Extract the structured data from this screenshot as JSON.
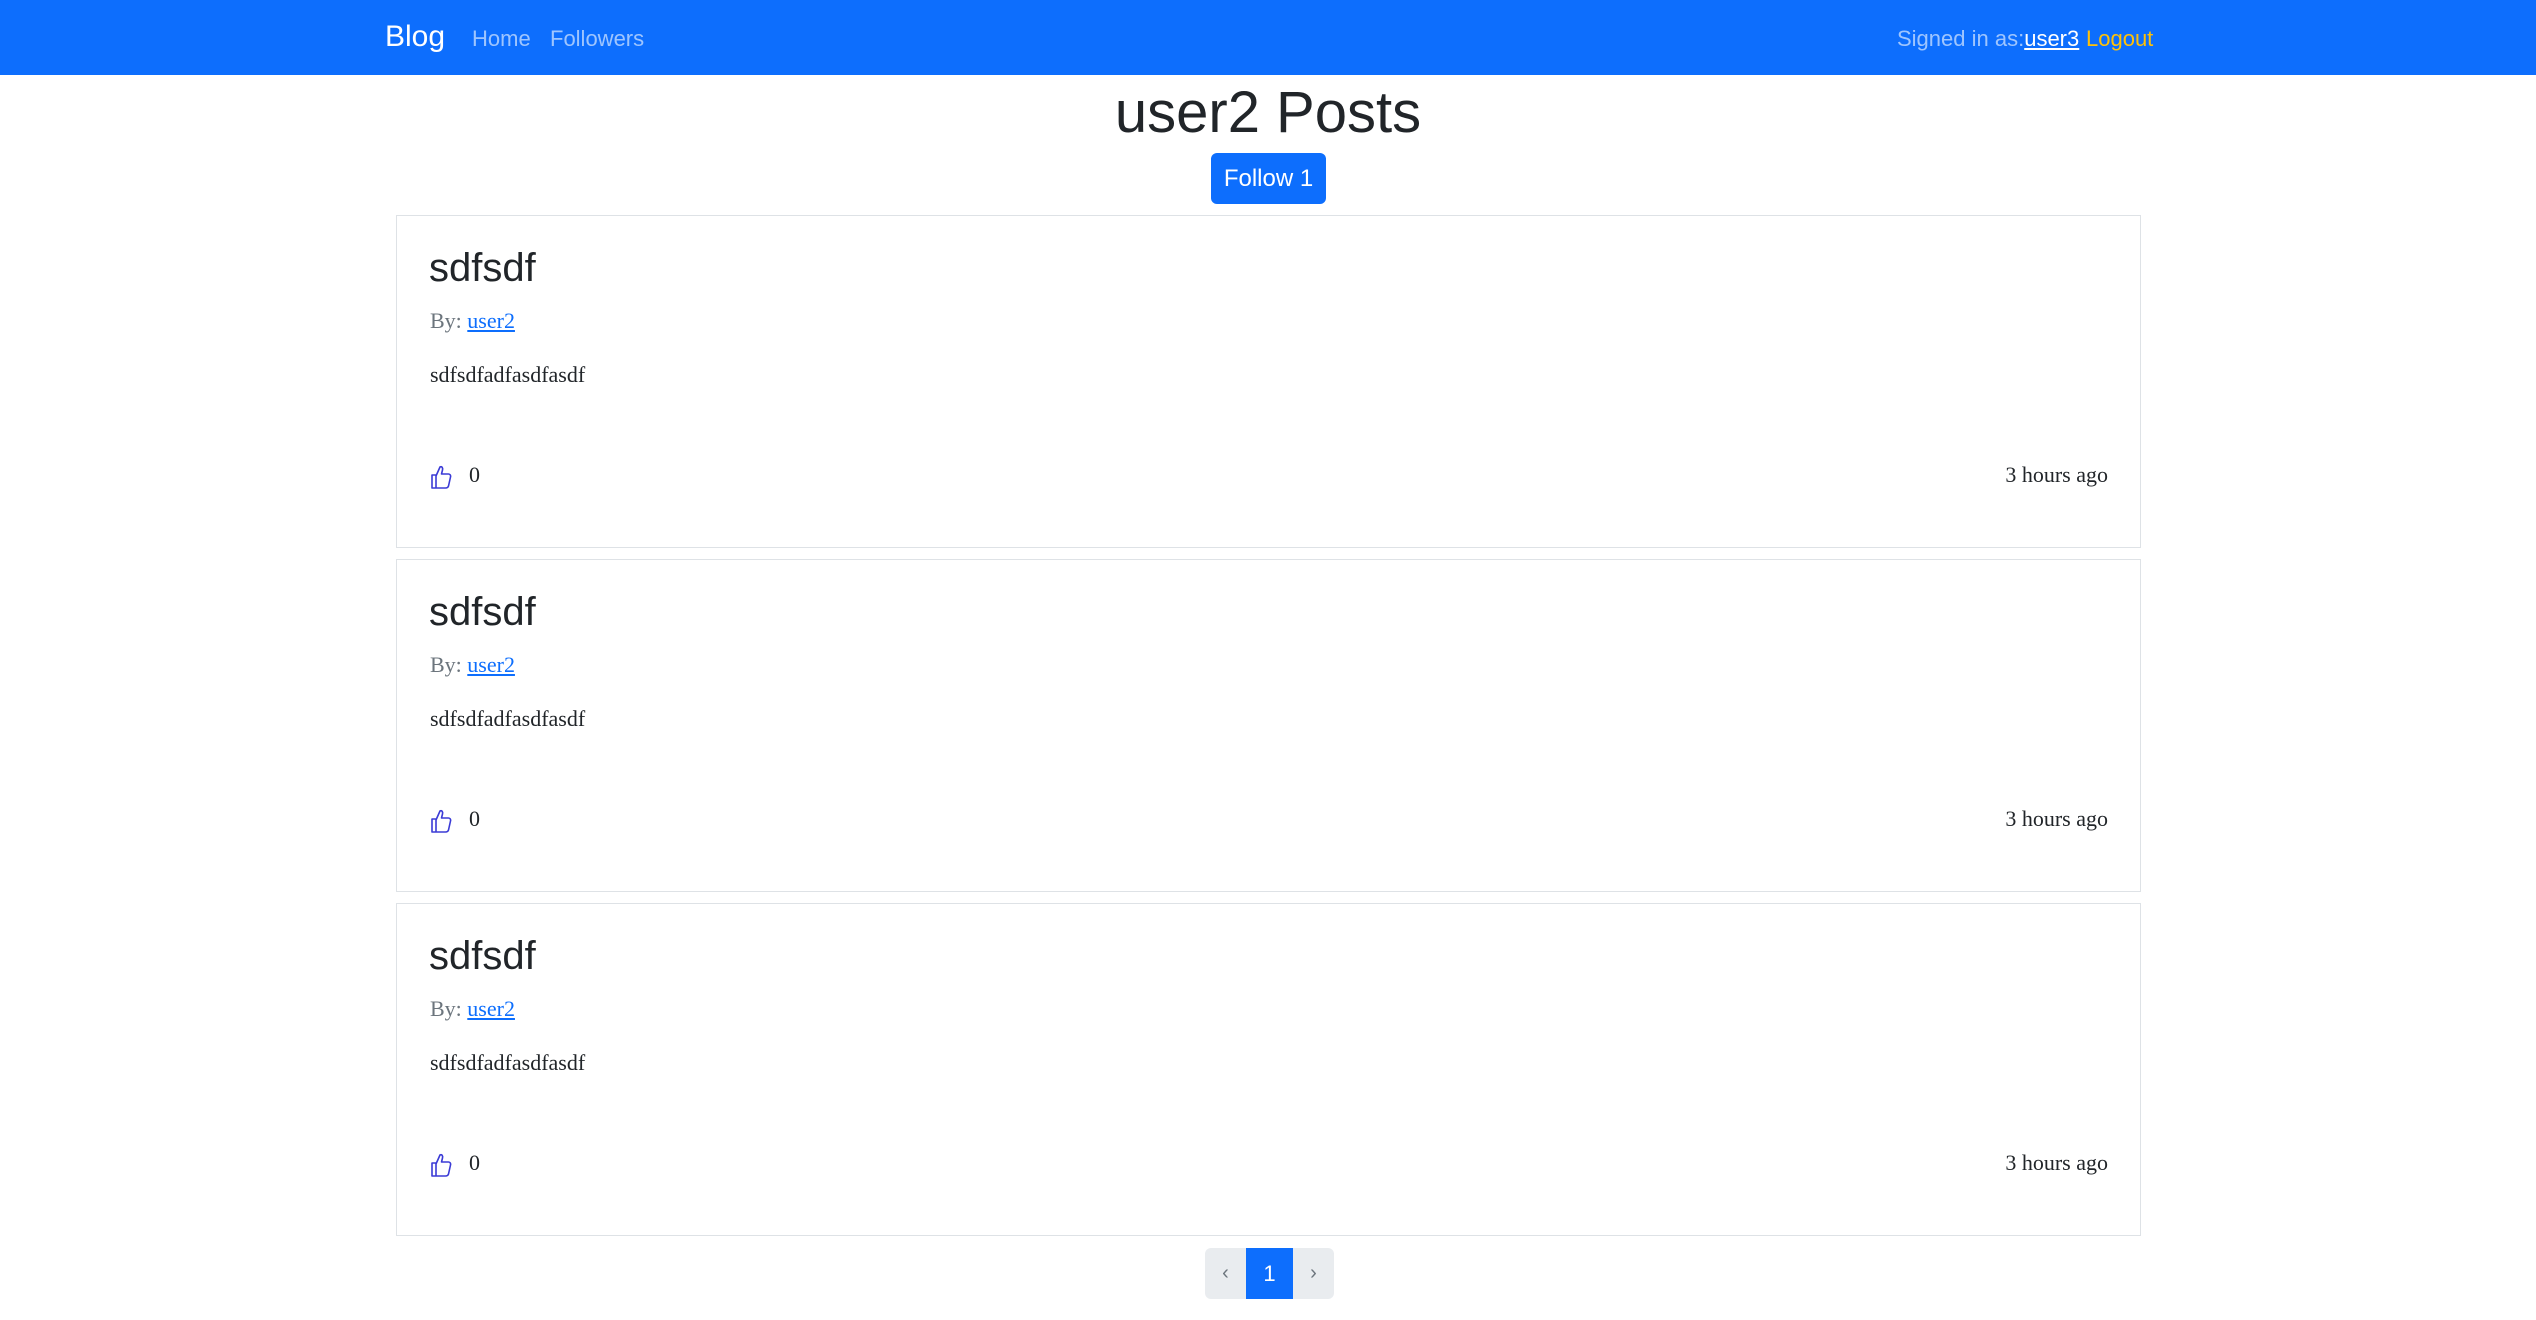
{
  "navbar": {
    "brand": "Blog",
    "home_label": "Home",
    "followers_label": "Followers",
    "signed_in_prefix": "Signed in as:",
    "signed_in_user": "user3",
    "logout_label": "Logout"
  },
  "page": {
    "title": "user2 Posts",
    "follow_label": "Follow 1"
  },
  "posts": [
    {
      "title": "sdfsdf",
      "by_prefix": "By: ",
      "author": "user2",
      "body": "sdfsdfadfasdfasdf",
      "likes": "0",
      "time": "3 hours ago"
    },
    {
      "title": "sdfsdf",
      "by_prefix": "By: ",
      "author": "user2",
      "body": "sdfsdfadfasdfasdf",
      "likes": "0",
      "time": "3 hours ago"
    },
    {
      "title": "sdfsdf",
      "by_prefix": "By: ",
      "author": "user2",
      "body": "sdfsdfadfasdfasdf",
      "likes": "0",
      "time": "3 hours ago"
    }
  ],
  "pagination": {
    "prev": "‹",
    "current": "1",
    "next": "›"
  },
  "colors": {
    "primary": "#0d6efd",
    "logout": "#ffc107",
    "like_icon": "#3b3bd6"
  },
  "icons": {
    "like": "thumbs-up-icon"
  }
}
